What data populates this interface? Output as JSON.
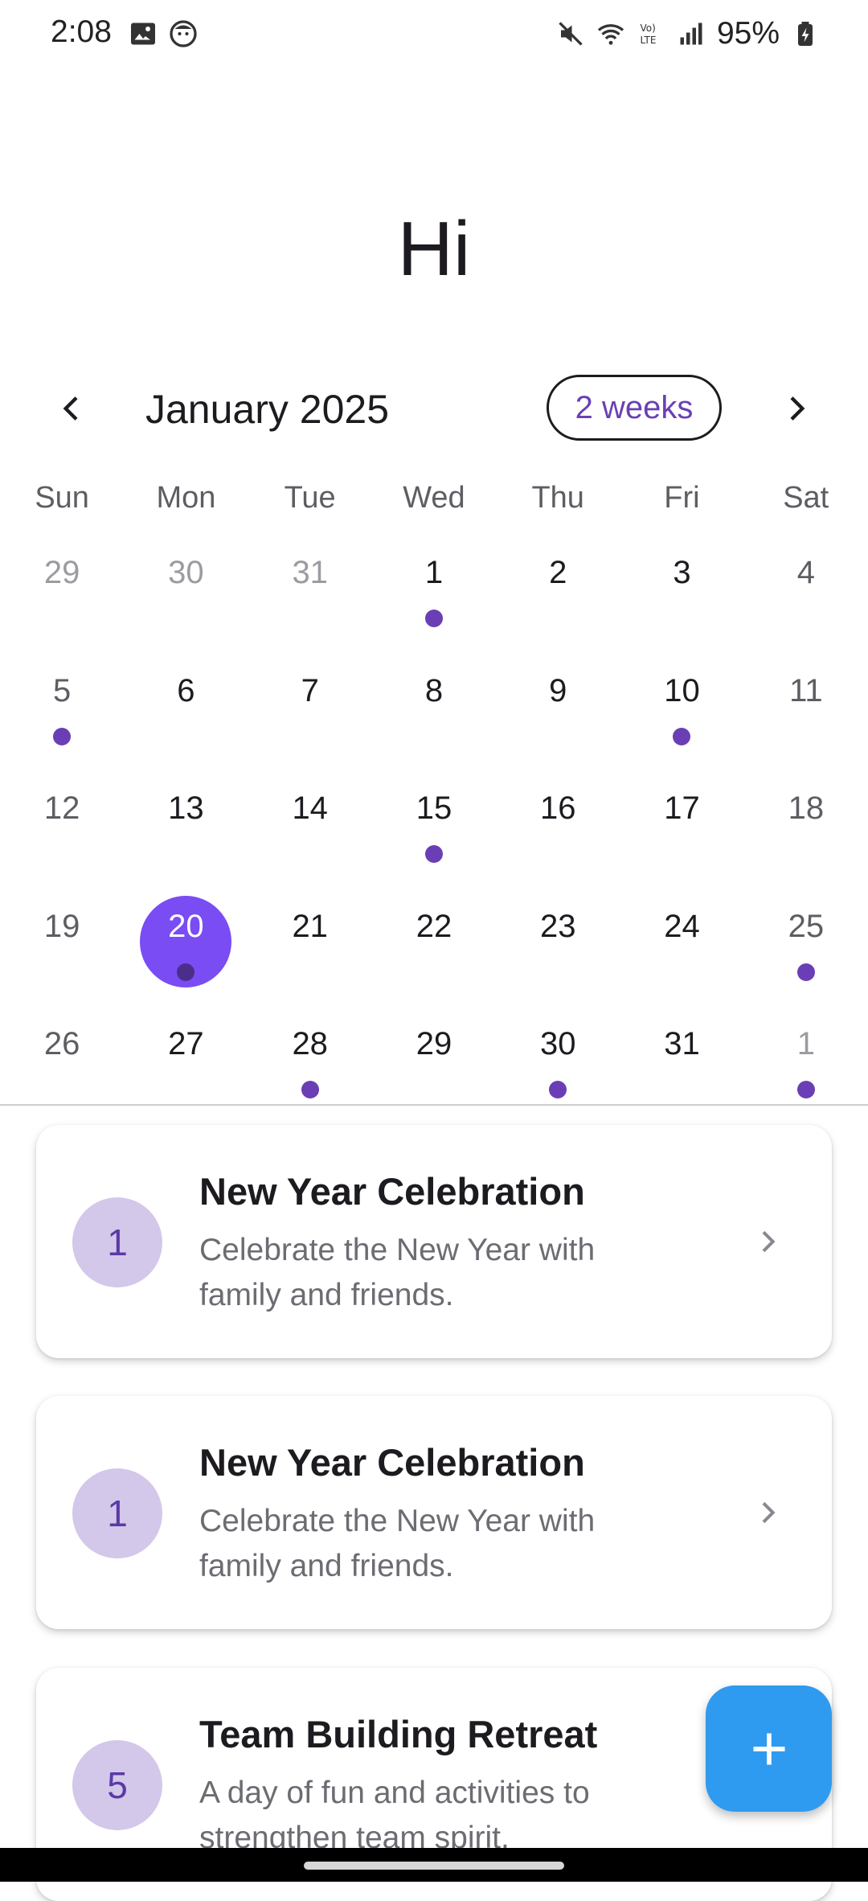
{
  "status_bar": {
    "time": "2:08",
    "battery": "95%",
    "icons": [
      "image-icon",
      "face-icon",
      "mute-icon",
      "wifi-icon",
      "volte-icon",
      "signal-icon",
      "battery-icon"
    ]
  },
  "greeting": "Hi",
  "calendar": {
    "month_label": "January 2025",
    "format_button": "2 weeks",
    "weekdays": [
      "Sun",
      "Mon",
      "Tue",
      "Wed",
      "Thu",
      "Fri",
      "Sat"
    ],
    "weeks": [
      [
        {
          "d": "29",
          "muted": true
        },
        {
          "d": "30",
          "muted": true
        },
        {
          "d": "31",
          "muted": true
        },
        {
          "d": "1",
          "dot": true
        },
        {
          "d": "2"
        },
        {
          "d": "3"
        },
        {
          "d": "4"
        }
      ],
      [
        {
          "d": "5",
          "dot": true
        },
        {
          "d": "6"
        },
        {
          "d": "7"
        },
        {
          "d": "8"
        },
        {
          "d": "9"
        },
        {
          "d": "10",
          "dot": true
        },
        {
          "d": "11"
        }
      ],
      [
        {
          "d": "12"
        },
        {
          "d": "13"
        },
        {
          "d": "14"
        },
        {
          "d": "15",
          "dot": true
        },
        {
          "d": "16"
        },
        {
          "d": "17"
        },
        {
          "d": "18"
        }
      ],
      [
        {
          "d": "19"
        },
        {
          "d": "20",
          "selected": true,
          "dot": true
        },
        {
          "d": "21"
        },
        {
          "d": "22"
        },
        {
          "d": "23"
        },
        {
          "d": "24"
        },
        {
          "d": "25",
          "dot": true
        }
      ],
      [
        {
          "d": "26"
        },
        {
          "d": "27"
        },
        {
          "d": "28",
          "dot": true
        },
        {
          "d": "29"
        },
        {
          "d": "30",
          "dot": true
        },
        {
          "d": "31"
        },
        {
          "d": "1",
          "muted": true,
          "dot": true
        }
      ]
    ],
    "accent_color": "#7a4cf3",
    "dot_color": "#6a3fb5"
  },
  "events": [
    {
      "badge": "1",
      "title": "New Year Celebration",
      "description": "Celebrate the New Year with family and friends."
    },
    {
      "badge": "1",
      "title": "New Year Celebration",
      "description": "Celebrate the New Year with family and friends."
    },
    {
      "badge": "5",
      "title": "Team Building Retreat",
      "description": "A day of fun and activities to strengthen team spirit."
    }
  ],
  "fab": {
    "icon": "plus-icon",
    "color": "#2f9bf0"
  }
}
